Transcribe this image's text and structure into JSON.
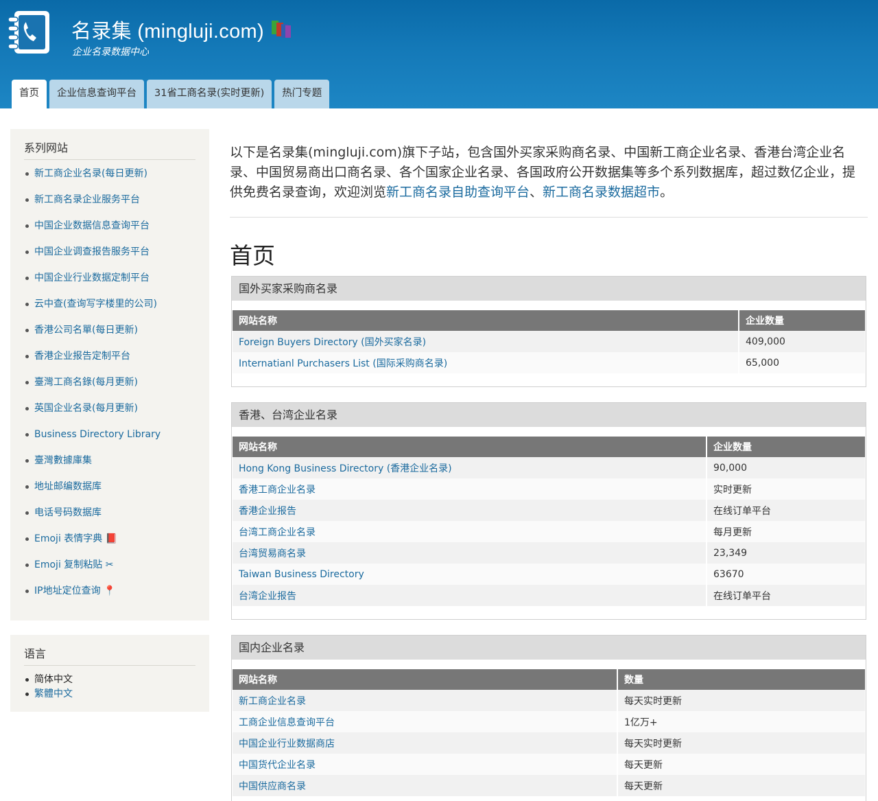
{
  "header": {
    "site_title": "名录集 (mingluji.com)",
    "tagline": "企业名录数据中心",
    "tabs": [
      {
        "label": "首页",
        "active": true
      },
      {
        "label": "企业信息查询平台",
        "active": false
      },
      {
        "label": "31省工商名录(实时更新)",
        "active": false
      },
      {
        "label": "热门专题",
        "active": false
      }
    ]
  },
  "sidebar": {
    "series_title": "系列网站",
    "series_items": [
      "新工商企业名录(每日更新)",
      "新工商名录企业服务平台",
      "中国企业数据信息查询平台",
      "中国企业调查报告服务平台",
      "中国企业行业数据定制平台",
      "云中查(查询写字楼里的公司)",
      "香港公司名單(每日更新)",
      "香港企业报告定制平台",
      "臺灣工商名錄(每月更新)",
      "英国企业名录(每月更新)",
      "Business Directory Library",
      "臺灣數據庫集",
      "地址邮编数据库",
      "电话号码数据库",
      "Emoji 表情字典 📕",
      "Emoji 复制粘贴 ✂",
      "IP地址定位查询 📍"
    ],
    "lang_title": "语言",
    "lang_items": [
      {
        "label": "简体中文",
        "current": true
      },
      {
        "label": "繁體中文",
        "current": false
      }
    ]
  },
  "main": {
    "intro_text": "以下是名录集(mingluji.com)旗下子站，包含国外买家采购商名录、中国新工商企业名录、香港台湾企业名录、中国贸易商出口商名录、各个国家企业名录、各国政府公开数据集等多个系列数据库，超过数亿企业，提供免费名录查询，欢迎浏览",
    "intro_link1": "新工商名录自助查询平台",
    "intro_sep": "、",
    "intro_link2": "新工商名录数据超市",
    "intro_end": "。",
    "page_heading": "首页",
    "panels": [
      {
        "title": "国外买家采购商名录",
        "col1": "网站名称",
        "col2": "企业数量",
        "rows": [
          {
            "name": "Foreign Buyers Directory (国外买家名录)",
            "value": "409,000"
          },
          {
            "name": "Internatianl Purchasers List (国际采购商名录)",
            "value": "65,000"
          }
        ]
      },
      {
        "title": "香港、台湾企业名录",
        "col1": "网站名称",
        "col2": "企业数量",
        "rows": [
          {
            "name": "Hong Kong Business Directory (香港企业名录)",
            "value": "90,000"
          },
          {
            "name": "香港工商企业名录",
            "value": "实时更新"
          },
          {
            "name": "香港企业报告",
            "value": "在线订单平台"
          },
          {
            "name": "台湾工商企业名录",
            "value": "每月更新"
          },
          {
            "name": "台湾贸易商名录",
            "value": "23,349"
          },
          {
            "name": "Taiwan Business Directory",
            "value": "63670"
          },
          {
            "name": "台湾企业报告",
            "value": "在线订单平台"
          }
        ]
      },
      {
        "title": "国内企业名录",
        "col1": "网站名称",
        "col2": "数量",
        "rows": [
          {
            "name": "新工商企业名录",
            "value": "每天实时更新"
          },
          {
            "name": "工商企业信息查询平台",
            "value": "1亿万+"
          },
          {
            "name": "中国企业行业数据商店",
            "value": "每天实时更新"
          },
          {
            "name": "中国货代企业名录",
            "value": "每天更新"
          },
          {
            "name": "中国供应商名录",
            "value": "每天更新"
          }
        ]
      }
    ]
  }
}
